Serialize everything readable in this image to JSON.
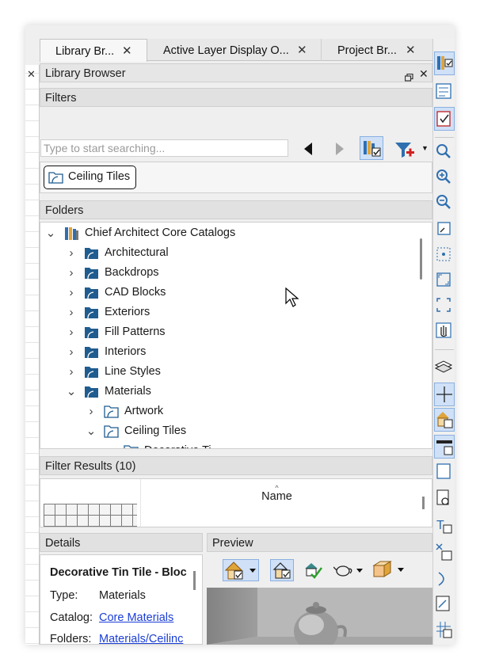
{
  "tabs": [
    {
      "label": "Library Br...",
      "close": "✕"
    },
    {
      "label": "Active Layer Display O...",
      "close": "✕"
    },
    {
      "label": "Project Br...",
      "close": "✕"
    }
  ],
  "left_close": "✕",
  "panel": {
    "title": "Library Browser",
    "float_icon": "float-icon",
    "close": "✕"
  },
  "filters": {
    "header": "Filters",
    "search_placeholder": "Type to start searching...",
    "chip": "Ceiling Tiles"
  },
  "folders": {
    "header": "Folders",
    "items": [
      {
        "label": "Chief Architect Core Catalogs",
        "chevron": "⌄",
        "icon": "catalogs-icon"
      },
      {
        "label": "Architectural",
        "chevron": "›",
        "icon": "folder-icon"
      },
      {
        "label": "Backdrops",
        "chevron": "›",
        "icon": "folder-icon"
      },
      {
        "label": "CAD Blocks",
        "chevron": "›",
        "icon": "folder-icon"
      },
      {
        "label": "Exteriors",
        "chevron": "›",
        "icon": "folder-icon"
      },
      {
        "label": "Fill Patterns",
        "chevron": "›",
        "icon": "folder-icon"
      },
      {
        "label": "Interiors",
        "chevron": "›",
        "icon": "folder-icon"
      },
      {
        "label": "Line Styles",
        "chevron": "›",
        "icon": "folder-icon"
      },
      {
        "label": "Materials",
        "chevron": "⌄",
        "icon": "folder-icon"
      },
      {
        "label": "Artwork",
        "chevron": "›",
        "icon": "folder-outline-icon"
      },
      {
        "label": "Ceiling Tiles",
        "chevron": "⌄",
        "icon": "folder-outline-icon"
      },
      {
        "label": "Decorative Ti...",
        "chevron": "›",
        "icon": "folder-outline-icon"
      }
    ]
  },
  "results": {
    "header": "Filter Results (10)",
    "column": "Name",
    "sort_arrow": "^"
  },
  "details": {
    "header": "Details",
    "title": "Decorative Tin Tile - Bloc",
    "type_label": "Type:",
    "type_value": "Materials",
    "catalog_label": "Catalog:",
    "catalog_value": "Core Materials",
    "folders_label": "Folders:",
    "folders_value": "Materials/Ceilinc"
  },
  "preview": {
    "header": "Preview"
  },
  "colors": {
    "accent": "#1a3dd6",
    "folder": "#1f5c8f",
    "selected": "#cfe0f7"
  }
}
